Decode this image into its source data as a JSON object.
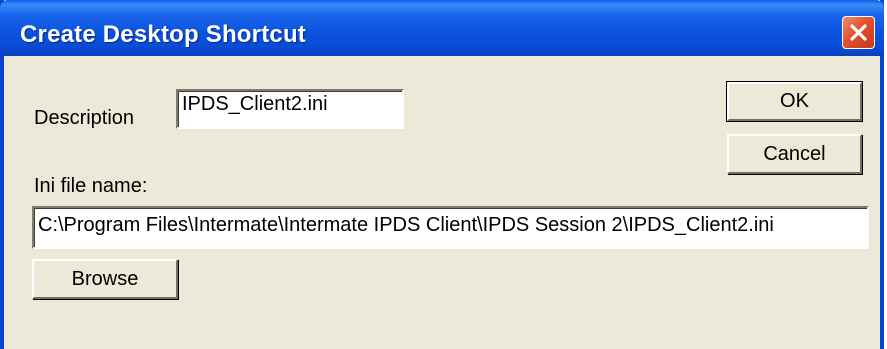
{
  "window": {
    "title": "Create Desktop Shortcut",
    "close_label": "Close"
  },
  "form": {
    "description_label": "Description",
    "description_value": "IPDS_Client2.ini",
    "ini_label": "Ini file name:",
    "ini_value": "C:\\Program Files\\Intermate\\Intermate IPDS Client\\IPDS Session 2\\IPDS_Client2.ini"
  },
  "buttons": {
    "ok_label": "OK",
    "cancel_label": "Cancel",
    "browse_label": "Browse"
  },
  "colors": {
    "titlebar": "#0a52dd",
    "dialog_bg": "#ece9d8",
    "close_button": "#e2502e"
  },
  "icons": {
    "close": "close-icon"
  }
}
